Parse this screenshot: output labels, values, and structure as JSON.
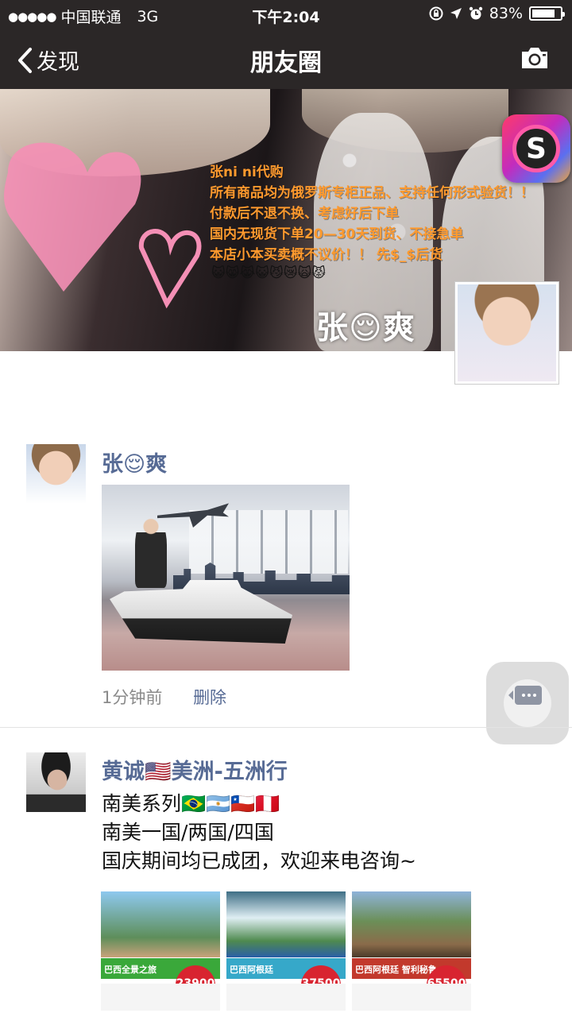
{
  "status_bar": {
    "signal": "●●●●●",
    "carrier": "中国联通",
    "network": "3G",
    "time": "下午2:04",
    "battery_text": "83%",
    "battery_level": 0.83
  },
  "nav": {
    "back_label": "发现",
    "title": "朋友圈"
  },
  "cover": {
    "lines": [
      "张ni ni代购",
      "所有商品均为俄罗斯专柜正品、支持任何形式验货！！",
      "付款后不退不换、考虑好后下单",
      "国内无现货下单20—30天到货、不接急单",
      "本店小本买卖概不议价！！ 先$_$后货"
    ],
    "emojis": "😺😸😹😺😼😿🙀😾",
    "owner_name": "张😌爽",
    "app_badge_letter": "S"
  },
  "posts": [
    {
      "author": "张😌爽",
      "time": "1分钟前",
      "delete_label": "删除"
    },
    {
      "author": "黄诚🇺🇸美洲-五洲行",
      "lines": [
        "南美系列🇧🇷🇦🇷🇨🇱🇵🇪",
        "南美一国/两国/四国",
        "国庆期间均已成团，欢迎来电咨询~"
      ],
      "thumbnails": [
        {
          "title": "巴西全景之旅",
          "price": "23900",
          "color": "#3aa83a"
        },
        {
          "title": "巴西阿根廷",
          "price": "37500",
          "color": "#36a8c9"
        },
        {
          "title": "巴西阿根廷 智利秘鲁",
          "price": "65500",
          "color": "#c2392c"
        }
      ]
    }
  ]
}
